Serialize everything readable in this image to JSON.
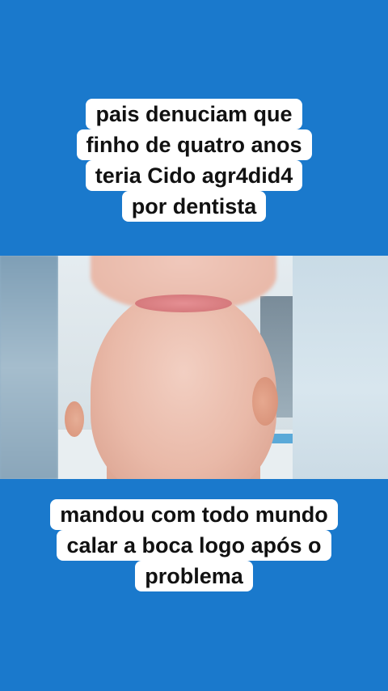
{
  "top_caption": {
    "lines": [
      "pais denuciam que",
      "finho de quatro anos",
      "teria Cido agr4did4",
      "por dentista"
    ]
  },
  "bottom_caption": {
    "lines": [
      "mandou com todo mundo",
      "calar a boca logo após o",
      "problema"
    ]
  },
  "colors": {
    "background": "#1a79cc",
    "caption_bg": "#ffffff",
    "caption_text": "#111111"
  }
}
